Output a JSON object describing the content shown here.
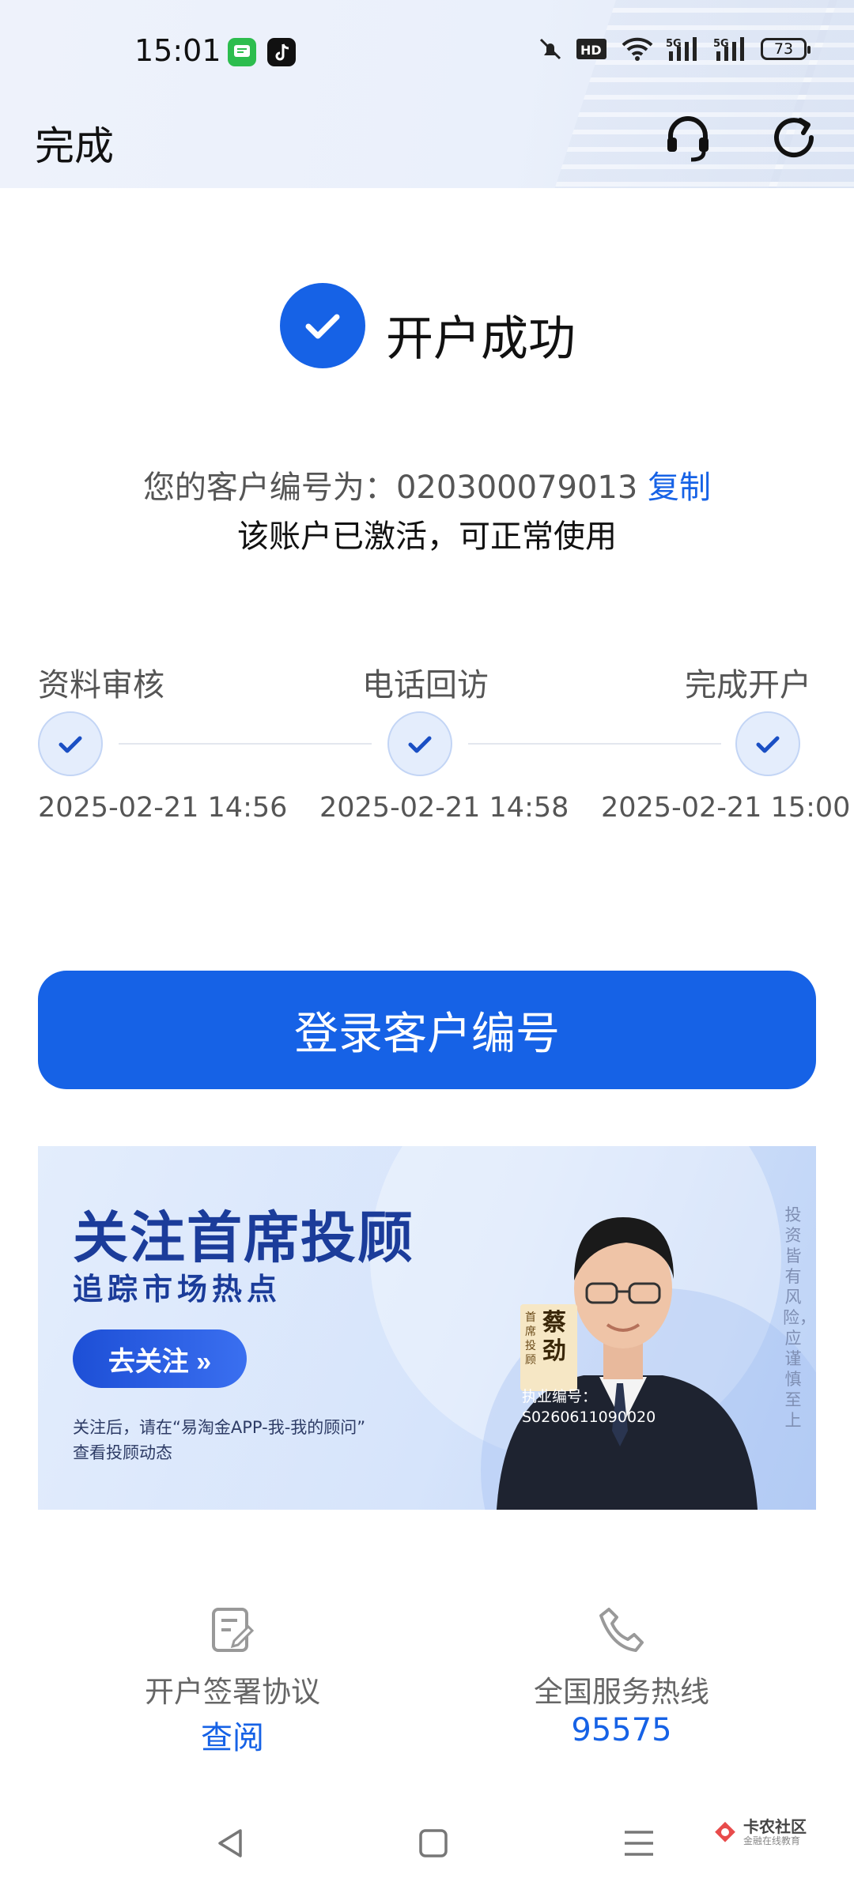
{
  "status_bar": {
    "time": "15:01",
    "battery": "73"
  },
  "header": {
    "done_label": "完成"
  },
  "success": {
    "title": "开户成功"
  },
  "customer": {
    "prefix": "您的客户编号为：",
    "number": "020300079013",
    "copy_label": "复制",
    "status": "该账户已激活，可正常使用"
  },
  "steps": [
    {
      "label": "资料审核",
      "time": "2025-02-21 14:56"
    },
    {
      "label": "电话回访",
      "time": "2025-02-21 14:58"
    },
    {
      "label": "完成开户",
      "time": "2025-02-21 15:00"
    }
  ],
  "login_button": "登录客户编号",
  "banner": {
    "title": "关注首席投顾",
    "subtitle": "追踪市场热点",
    "button": "去关注 »",
    "note_line1": "关注后，请在“易淘金APP-我-我的顾问”",
    "note_line2": "查看投顾动态",
    "risk": "投资皆有风险，应谨慎至上",
    "tag_role": "首席投顾",
    "tag_name": "蔡劲",
    "license_label": "执业编号：",
    "license_number": "S0260611090020"
  },
  "footer": {
    "agreement_label": "开户签署协议",
    "agreement_link": "查阅",
    "hotline_label": "全国服务热线",
    "hotline_number": "95575"
  },
  "watermark": {
    "name": "卡农社区",
    "tagline": "金融在线教育"
  },
  "colors": {
    "accent": "#1662e6",
    "banner_title": "#1b3c9a"
  }
}
